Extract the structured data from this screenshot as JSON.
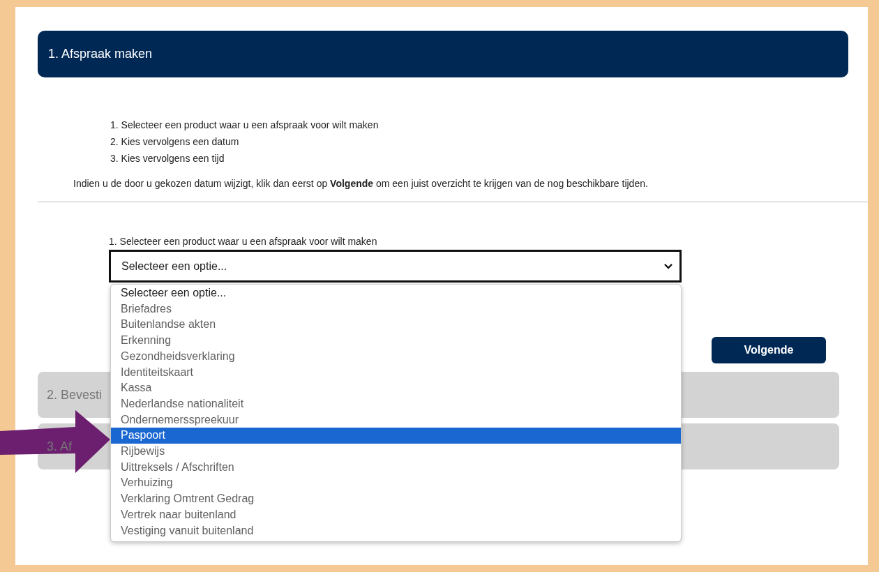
{
  "header": {
    "title": "1. Afspraak maken"
  },
  "steps": [
    "1. Selecteer een product waar u een afspraak voor wilt maken",
    "2. Kies vervolgens een datum",
    "3. Kies vervolgens een tijd"
  ],
  "note": "Indien u de door u gekozen datum wijzigt, klik dan eerst op **Volgende** om een juist overzicht te krijgen van de nog beschikbare tijden.",
  "product_field": {
    "label": "1. Selecteer een product waar u een afspraak voor wilt maken",
    "value": "Selecteer een optie...",
    "expanded": true
  },
  "options": [
    {
      "label": "Selecteer een optie...",
      "kind": "placeholder",
      "selected": false
    },
    {
      "label": "Briefadres",
      "kind": "option",
      "selected": false
    },
    {
      "label": "Buitenlandse akten",
      "kind": "option",
      "selected": false
    },
    {
      "label": "Erkenning",
      "kind": "option",
      "selected": false
    },
    {
      "label": "Gezondheidsverklaring",
      "kind": "option",
      "selected": false
    },
    {
      "label": "Identiteitskaart",
      "kind": "option",
      "selected": false
    },
    {
      "label": "Kassa",
      "kind": "option",
      "selected": false
    },
    {
      "label": "Nederlandse nationaliteit",
      "kind": "option",
      "selected": false
    },
    {
      "label": "Ondernemersspreekuur",
      "kind": "option",
      "selected": false
    },
    {
      "label": "Paspoort",
      "kind": "option",
      "selected": true
    },
    {
      "label": "Rijbewijs",
      "kind": "option",
      "selected": false
    },
    {
      "label": "Uittreksels / Afschriften",
      "kind": "option",
      "selected": false
    },
    {
      "label": "Verhuizing",
      "kind": "option",
      "selected": false
    },
    {
      "label": "Verklaring Omtrent Gedrag",
      "kind": "option",
      "selected": false
    },
    {
      "label": "Vertrek naar buitenland",
      "kind": "option",
      "selected": false
    },
    {
      "label": "Vestiging vanuit buitenland",
      "kind": "option",
      "selected": false
    }
  ],
  "next_button": "Volgende",
  "sections": [
    {
      "title": "2. Bevesti"
    },
    {
      "title": "3. Af"
    }
  ]
}
